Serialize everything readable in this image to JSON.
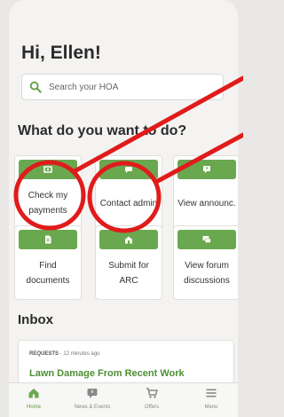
{
  "header": {
    "greeting": "Hi, Ellen!"
  },
  "search": {
    "placeholder": "Search your HOA",
    "icon": "search-icon"
  },
  "actions": {
    "title": "What do you want to do?",
    "tiles": [
      {
        "label": "Check my\npayments",
        "icon": "payment-icon"
      },
      {
        "label": "Contact admin",
        "icon": "chat-icon"
      },
      {
        "label": "View announc.",
        "icon": "announcement-icon"
      },
      {
        "label": "Find\ndocuments",
        "icon": "document-icon"
      },
      {
        "label": "Submit for\nARC",
        "icon": "home-building-icon"
      },
      {
        "label": "View forum\ndiscussions",
        "icon": "forum-icon"
      }
    ]
  },
  "inbox": {
    "title": "Inbox",
    "card": {
      "category": "REQUESTS",
      "time": "· 12 minutes ago",
      "subject": "Lawn Damage From Recent Work"
    }
  },
  "nav": [
    {
      "label": "Home",
      "icon": "home-icon",
      "active": true
    },
    {
      "label": "News & Events",
      "icon": "news-icon",
      "active": false
    },
    {
      "label": "Offers",
      "icon": "cart-icon",
      "active": false
    },
    {
      "label": "Menu",
      "icon": "menu-icon",
      "active": false
    }
  ],
  "colors": {
    "accent": "#6aa84f",
    "annotation": "#e01b1b",
    "subject": "#4d8f33"
  }
}
